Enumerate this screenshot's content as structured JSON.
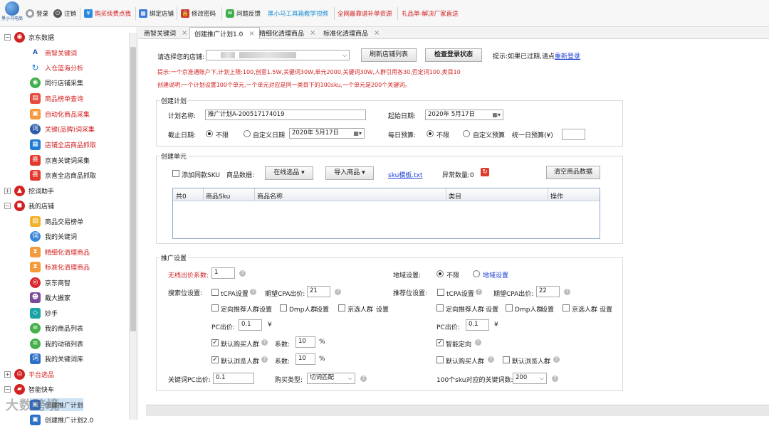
{
  "toolbar": {
    "logo_text": "黑小马电商",
    "items": [
      {
        "label": "登录"
      },
      {
        "label": "注销"
      },
      {
        "label": "购买续费点我"
      },
      {
        "label": "绑定店铺"
      },
      {
        "label": "修改密码"
      },
      {
        "label": "问题反馈"
      },
      {
        "label": "黑小马工具箱教学视频"
      },
      {
        "label": "全网最靠谱补单资源"
      },
      {
        "label": "礼品单-解决厂家直送"
      }
    ]
  },
  "sidebar": {
    "groups": [
      {
        "label": "京东数据",
        "items": [
          "商智关键词",
          "入仓蓝海分析",
          "同行店铺采集",
          "商品榜单查询",
          "自动化商品采集",
          "关键(品牌)词采集",
          "店铺全店商品抓取",
          "京喜关键词采集",
          "京喜全店商品抓取"
        ]
      },
      {
        "label": "挖词助手"
      },
      {
        "label": "我的店铺",
        "items": [
          "商品交易榜单",
          "我的关键词",
          "精细化清理商品",
          "标准化清理商品",
          "京东商智",
          "戴大搬家",
          "妙手",
          "我的商品列表",
          "我的动销列表",
          "我的关键词库"
        ]
      },
      {
        "label": "平台选品"
      },
      {
        "label": "智能快车",
        "items": [
          "创建推广计划",
          "创建推广计划2.0"
        ]
      }
    ],
    "watermark": "大数跨境"
  },
  "tabs": [
    {
      "label": "商智关键词"
    },
    {
      "label": "创建推广计划1.0"
    },
    {
      "label": "精细化清理商品"
    },
    {
      "label": "标准化清理商品"
    }
  ],
  "store": {
    "label": "请选择您的店铺:",
    "refresh_button": "刷新店铺列表",
    "check_button": "检查登录状态",
    "hint_text": "提示:如果已过期,请点",
    "relogin_link": "重新登录"
  },
  "notices": [
    "提示:一个京准通账户下,计划上限:100,创意1.5W,关键词30W,单元2000,关键词30W,人群引用各30,否定词100,类目10",
    "创建说明:一个计划设置100个单元,一个单元对应是同一类目下的100sku,一个单元是200个关键词。"
  ],
  "plan": {
    "section_title": "创建计划",
    "name_label": "计划名称:",
    "name_value": "推广计划A-200517174019",
    "start_label": "起始日期:",
    "start_value": "2020年 5月17日",
    "end_label": "截止日期:",
    "end_unlimited": "不限",
    "end_custom": "自定义日期",
    "end_value": "2020年 5月17日",
    "budget_label": "每日预算:",
    "budget_unlimited": "不限",
    "budget_custom": "自定义预算",
    "unified_budget_label": "统一日预算(¥)"
  },
  "unit": {
    "section_title": "创建单元",
    "add_same_sku": "添加同款SKU",
    "product_data_label": "商品数据:",
    "online_select_button": "在线选品",
    "import_button": "导入商品",
    "sku_template_link": "sku模板.txt",
    "error_count_label": "异常数量:0",
    "clear_button": "清空商品数据",
    "table_headers": [
      "共0",
      "商品Sku",
      "商品名称",
      "类目",
      "操作"
    ]
  },
  "promo": {
    "section_title": "推广设置",
    "wireless_label": "无线出价系数:",
    "wireless_value": "1",
    "region_label": "地域设置:",
    "region_unlimited": "不限",
    "region_link": "地域设置",
    "search_label": "搜索位设置:",
    "tcpa_label": "tCPA设置",
    "cpa_label": "期望CPA出价:",
    "search_cpa_value": "21",
    "recommend_label": "推荐位设置:",
    "recommend_cpa_value": "22",
    "directional_crowd": "定向推荐人群",
    "setting": "设置",
    "dmp_crowd": "Dmp人群",
    "jd_crowd": "京选人群",
    "pc_bid_label": "PC出价:",
    "pc_bid_value": "0.1",
    "yen": "¥",
    "default_buy_crowd": "默认购买人群",
    "coefficient_label": "系数:",
    "buy_coef_value": "10",
    "percent": "%",
    "default_browse_crowd": "默认浏览人群",
    "browse_coef_value": "10",
    "smart_targeting": "智能定向",
    "keyword_pc_label": "关键词PC出价:",
    "keyword_pc_value": "0.1",
    "buy_type_label": "购买类型:",
    "buy_type_value": "切词匹配",
    "keyword_count_label": "100个sku对应的关键词数:",
    "keyword_count_value": "200"
  },
  "colors": {
    "notice_red": "#d21f1f",
    "link_blue": "#1a3fd6"
  }
}
